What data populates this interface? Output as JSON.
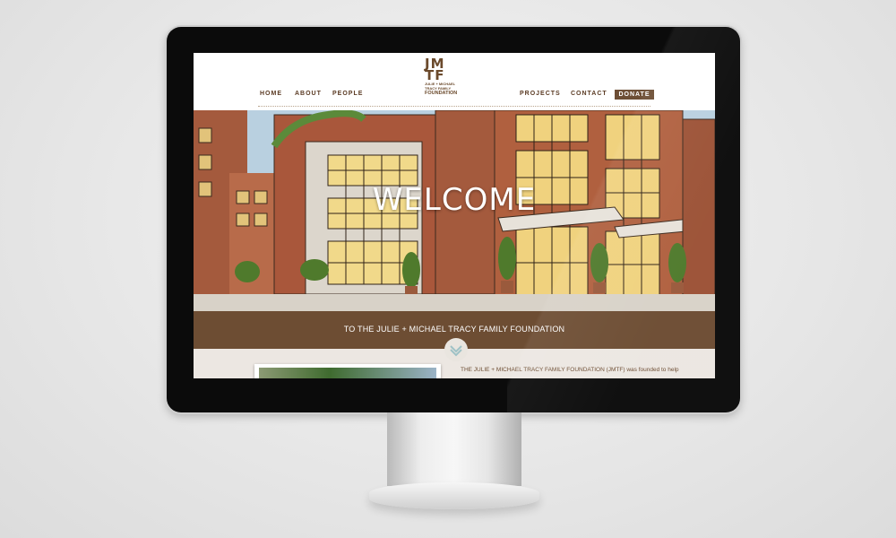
{
  "site": {
    "logo": {
      "mark_top": "JM",
      "mark_bottom": "TF",
      "line1": "JULIE + MICHAEL",
      "line2": "TRACY FAMILY",
      "line3": "FOUNDATION"
    },
    "nav_left": [
      "HOME",
      "ABOUT",
      "PEOPLE"
    ],
    "nav_right": [
      "PROJECTS",
      "CONTACT"
    ],
    "donate": "DONATE"
  },
  "hero": {
    "heading": "WELCOME"
  },
  "band": {
    "tagline": "TO THE JULIE + MICHAEL TRACY FAMILY FOUNDATION"
  },
  "intro": {
    "text": "THE JULIE + MICHAEL TRACY FAMILY FOUNDATION (JMTF) was founded to help"
  },
  "colors": {
    "brand_brown": "#6d4d33",
    "nav_text": "#5b3b24"
  }
}
